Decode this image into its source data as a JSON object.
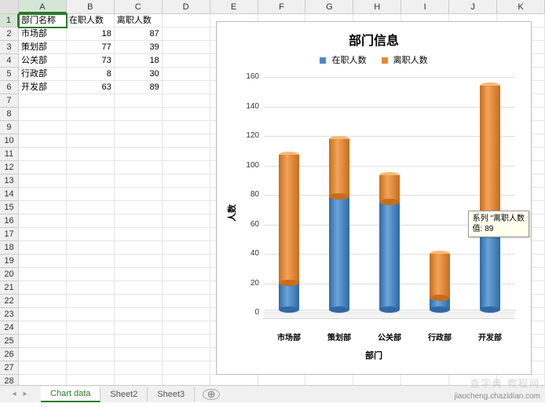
{
  "columns": [
    "A",
    "B",
    "C",
    "D",
    "E",
    "F",
    "G",
    "H",
    "I",
    "J",
    "K"
  ],
  "selected_cell": "A1",
  "headers": {
    "a": "部门名称",
    "b": "在职人数",
    "c": "离职人数"
  },
  "rows": [
    {
      "a": "市场部",
      "b": 18,
      "c": 87
    },
    {
      "a": "策划部",
      "b": 77,
      "c": 39
    },
    {
      "a": "公关部",
      "b": 73,
      "c": 18
    },
    {
      "a": "行政部",
      "b": 8,
      "c": 30
    },
    {
      "a": "开发部",
      "b": 63,
      "c": 89
    }
  ],
  "chart_data": {
    "type": "bar",
    "stacked": true,
    "style": "cylinder-3d",
    "title": "部门信息",
    "xlabel": "部门",
    "ylabel": "人数",
    "ylim": [
      0,
      160
    ],
    "ytick_interval": 20,
    "categories": [
      "市场部",
      "策划部",
      "公关部",
      "行政部",
      "开发部"
    ],
    "series": [
      {
        "name": "在职人数",
        "color": "#4a89c8",
        "values": [
          18,
          77,
          73,
          8,
          63
        ]
      },
      {
        "name": "离职人数",
        "color": "#e68a2e",
        "values": [
          87,
          39,
          18,
          30,
          89
        ]
      }
    ],
    "legend_position": "top"
  },
  "tooltip": {
    "line1": "系列 \"离职人数",
    "line2": "值: 89"
  },
  "sheet_tabs": {
    "active": "Chart data",
    "tabs": [
      "Chart data",
      "Sheet2",
      "Sheet3"
    ]
  },
  "watermark1": "jiaocheng.chazidian.com",
  "watermark2": "查字典 教程网"
}
